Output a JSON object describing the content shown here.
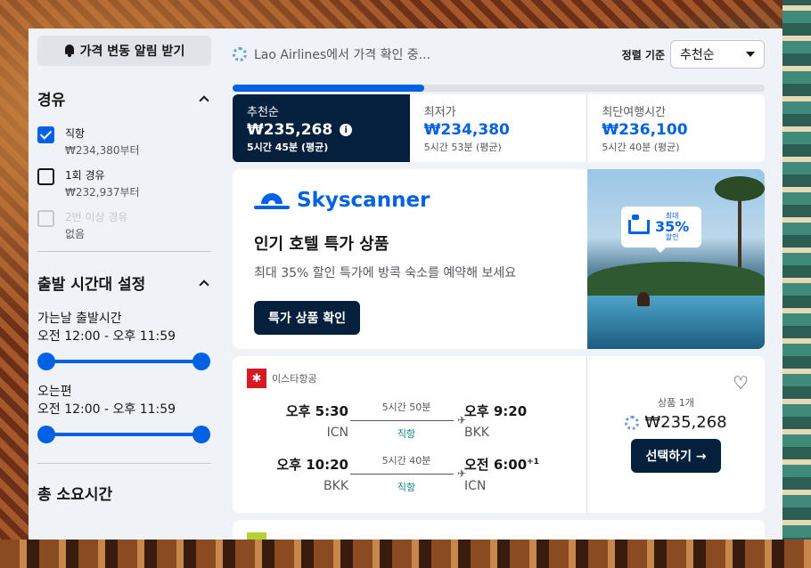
{
  "sidebar": {
    "alert_button": "가격 변동 알림 받기",
    "stops": {
      "title": "경유",
      "items": [
        {
          "label": "직항",
          "sub": "₩234,380부터",
          "checked": true,
          "disabled": false
        },
        {
          "label": "1회 경유",
          "sub": "₩232,937부터",
          "checked": false,
          "disabled": false
        },
        {
          "label": "2번 이상 경유",
          "sub": "없음",
          "checked": false,
          "disabled": true
        }
      ]
    },
    "times": {
      "title": "출발 시간대 설정",
      "outbound_label": "가는날 출발시간",
      "outbound_range": "오전 12:00 - 오후 11:59",
      "return_label": "오는편",
      "return_range": "오전 12:00 - 오후 11:59"
    },
    "next_section_partial": "총 소요시간"
  },
  "main": {
    "loading_text": "Lao Airlines에서 가격 확인 중...",
    "sort_label": "정렬 기준",
    "sort_value": "추천순",
    "progress": 0.36,
    "tabs": [
      {
        "name": "추천순",
        "price": "₩235,268",
        "duration": "5시간 45분 (평균)",
        "active": true
      },
      {
        "name": "최저가",
        "price": "₩234,380",
        "duration": "5시간 53분 (평균)",
        "active": false
      },
      {
        "name": "최단여행시간",
        "price": "₩236,100",
        "duration": "5시간 40분 (평균)",
        "active": false
      }
    ],
    "promo": {
      "brand": "Skyscanner",
      "title": "인기 호텔 특가 상품",
      "subtitle": "최대 35% 할인 특가에 방콕 숙소를 예약해 보세요",
      "button": "특가 상품 확인",
      "badge_small_top": "최대",
      "badge_big": "35%",
      "badge_small_bottom": "할인"
    },
    "flight": {
      "airline": "이스타항공",
      "legs": [
        {
          "dep_time": "오후 5:30",
          "dep_apt": "ICN",
          "duration": "5시간 50분",
          "stops": "직항",
          "arr_time": "오후 9:20",
          "arr_day": "",
          "arr_apt": "BKK"
        },
        {
          "dep_time": "오후 10:20",
          "dep_apt": "BKK",
          "duration": "5시간 40분",
          "stops": "직항",
          "arr_time": "오전 6:00",
          "arr_day": "+1",
          "arr_apt": "ICN"
        }
      ],
      "deals_count": "상품 1개",
      "price": "₩235,268",
      "select_button": "선택하기 →"
    },
    "colors": {
      "accent": "#0062e3",
      "dark": "#05203c",
      "direct": "#0c838a"
    }
  }
}
